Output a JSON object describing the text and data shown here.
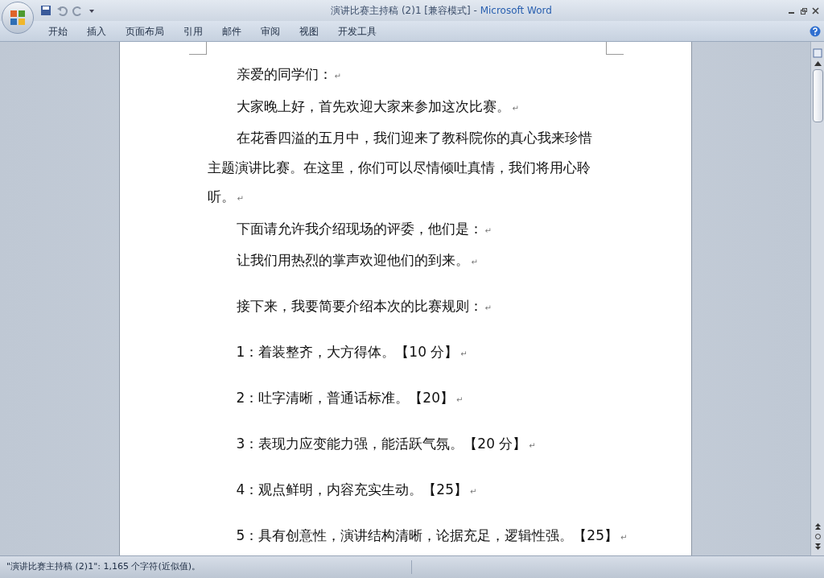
{
  "window": {
    "title_doc": "演讲比赛主持稿 (2)1 [兼容模式]",
    "title_sep": " - ",
    "title_app": "Microsoft Word"
  },
  "ribbon_tabs": [
    "开始",
    "插入",
    "页面布局",
    "引用",
    "邮件",
    "审阅",
    "视图",
    "开发工具"
  ],
  "document": {
    "paragraphs": [
      {
        "kind": "tight",
        "text": "亲爱的同学们：",
        "mark": "↵"
      },
      {
        "kind": "tight",
        "text": "大家晚上好，首先欢迎大家来参加这次比赛。",
        "mark": "↵"
      },
      {
        "kind": "tight",
        "lines": [
          "在花香四溢的五月中，我们迎来了教科院你的真心我来珍惜",
          "主题演讲比赛。在这里，你们可以尽情倾吐真情，我们将用心聆",
          "听。"
        ],
        "mark": "↵"
      },
      {
        "kind": "tight",
        "text": "下面请允许我介绍现场的评委，他们是：",
        "mark": "↵"
      },
      {
        "kind": "tight",
        "text": "让我们用热烈的掌声欢迎他们的到来。",
        "mark": "↵"
      },
      {
        "kind": "spaced",
        "text": "接下来，我要简要介绍本次的比赛规则：",
        "mark": "↵"
      },
      {
        "kind": "spaced",
        "text": "1：着装整齐，大方得体。【10 分】",
        "mark": "↵"
      },
      {
        "kind": "spaced",
        "text": "2：吐字清晰，普通话标准。【20】",
        "mark": "↵"
      },
      {
        "kind": "spaced",
        "text": "3：表现力应变能力强，能活跃气氛。【20 分】",
        "mark": "↵"
      },
      {
        "kind": "spaced",
        "text": "4：观点鲜明，内容充实生动。【25】",
        "mark": "↵"
      },
      {
        "kind": "spaced",
        "text": "5：具有创意性，演讲结构清晰，论据充足，逻辑性强。【25】",
        "mark": "↵"
      }
    ]
  },
  "status_bar": {
    "text": "\"演讲比赛主持稿 (2)1\": 1,165 个字符(近似值)。"
  }
}
